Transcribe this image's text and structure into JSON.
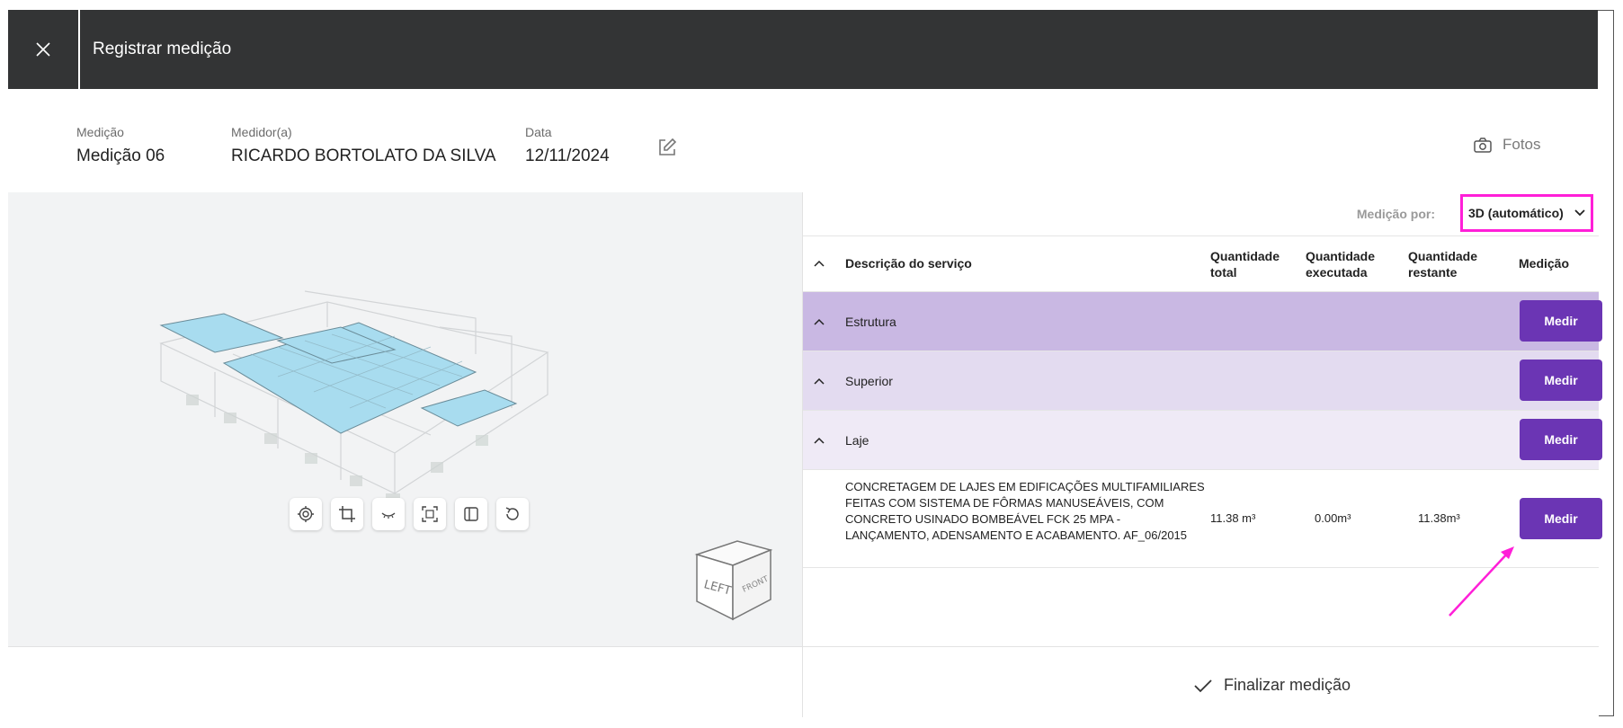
{
  "header": {
    "title": "Registrar medição",
    "close_icon": "close-icon"
  },
  "info": {
    "medicao_label": "Medição",
    "medicao_value": "Medição 06",
    "medidor_label": "Medidor(a)",
    "medidor_value": "RICARDO BORTOLATO DA SILVA",
    "data_label": "Data",
    "data_value": "12/11/2024",
    "edit_icon": "edit-icon",
    "fotos_label": "Fotos",
    "fotos_icon": "camera-icon"
  },
  "viewer": {
    "tools": [
      "focus-icon",
      "crop-icon",
      "hide-icon",
      "fit-icon",
      "section-icon",
      "reset-icon"
    ],
    "cube_faces": [
      "LEFT",
      "FRONT"
    ]
  },
  "selector": {
    "label": "Medição por:",
    "value": "3D (automático)"
  },
  "table": {
    "headers": {
      "descricao": "Descrição do serviço",
      "qtd_total": "Quantidade total",
      "qtd_executada": "Quantidade executada",
      "qtd_restante": "Quantidade restante",
      "medicao": "Medição"
    },
    "groups": [
      {
        "name": "Estrutura",
        "button": "Medir",
        "color": "#c9b8e3"
      },
      {
        "name": "Superior",
        "button": "Medir",
        "color": "#e3dbf0"
      },
      {
        "name": "Laje",
        "button": "Medir",
        "color": "#efeaf6"
      }
    ],
    "item": {
      "descricao": "CONCRETAGEM DE LAJES EM EDIFICAÇÕES MULTIFAMILIARES FEITAS COM SISTEMA DE FÔRMAS MANUSEÁVEIS, COM CONCRETO USINADO BOMBEÁVEL FCK 25 MPA - LANÇAMENTO, ADENSAMENTO E ACABAMENTO. AF_06/2015",
      "qtd_total": "11.38 m³",
      "qtd_executada": "0.00m³",
      "qtd_restante": "11.38m³",
      "button": "Medir"
    }
  },
  "footer": {
    "finalize_label": "Finalizar medição",
    "finalize_icon": "check-icon"
  },
  "colors": {
    "accent": "#6b35b4",
    "highlight": "#ff1fd8",
    "topbar": "#333435"
  }
}
